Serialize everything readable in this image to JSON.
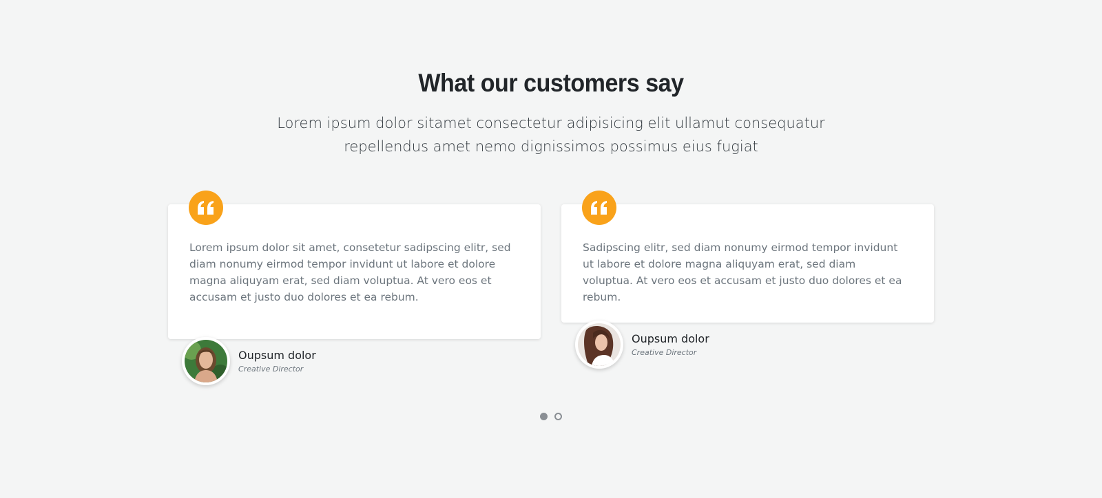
{
  "section": {
    "title": "What our customers say",
    "subtitle": "Lorem ipsum dolor sitamet consectetur adipisicing elit ullamut consequatur repellendus amet nemo dignissimos possimus eius fugiat"
  },
  "testimonials": [
    {
      "text": "Lorem ipsum dolor sit amet, consetetur sadipscing elitr, sed diam nonumy eirmod tempor invidunt ut labore et dolore magna aliquyam erat, sed diam voluptua. At vero eos et accusam et justo duo dolores et ea rebum.",
      "name": "Oupsum dolor",
      "role": "Creative Director",
      "icon": "quote-icon"
    },
    {
      "text": "Sadipscing elitr, sed diam nonumy eirmod tempor invidunt ut labore et dolore magna aliquyam erat, sed diam voluptua. At vero eos et accusam et justo duo dolores et ea rebum.",
      "name": "Oupsum dolor",
      "role": "Creative Director",
      "icon": "quote-icon"
    }
  ],
  "carousel": {
    "pages": 2,
    "active_page": 1
  },
  "colors": {
    "accent": "#f9a21a",
    "background": "#f4f5f5",
    "card": "#ffffff",
    "heading": "#212529",
    "body_text": "#6c757d"
  }
}
